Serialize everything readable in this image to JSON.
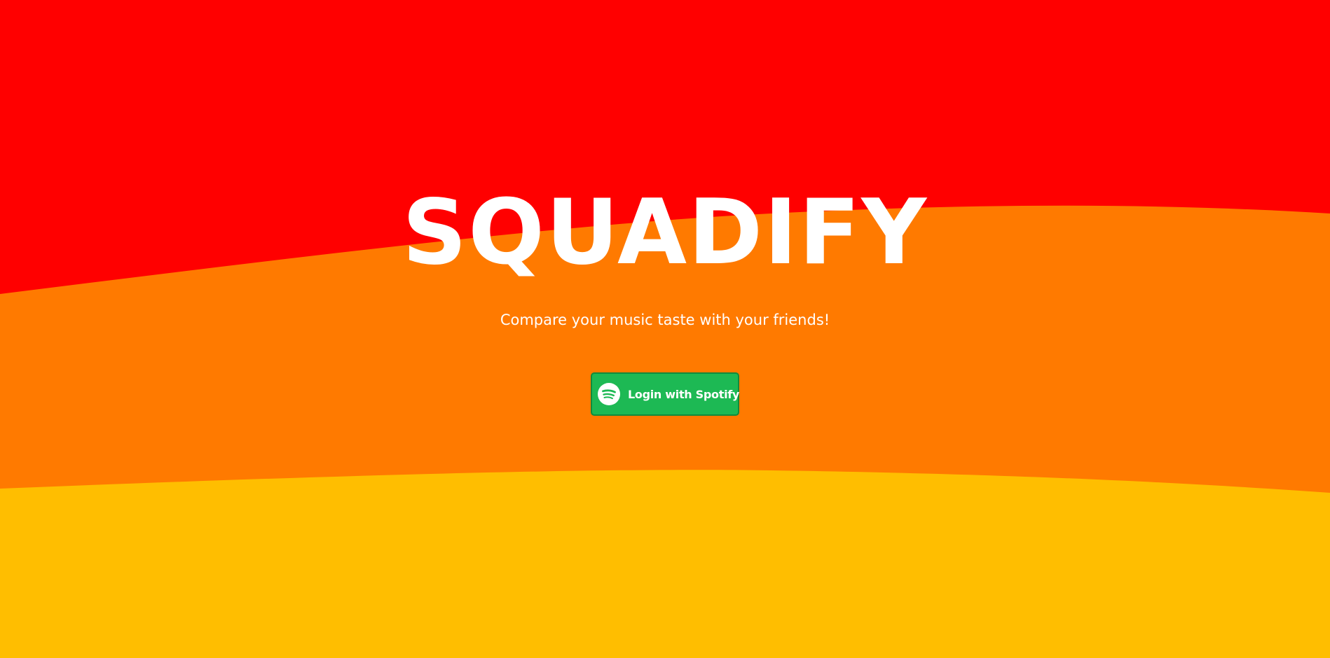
{
  "colors": {
    "top_band": "#ff0000",
    "middle_band": "#ff7a00",
    "bottom_band": "#ffbe00",
    "text": "#ffffff",
    "spotify_green": "#1db954"
  },
  "hero": {
    "title": "SQUADIFY",
    "subtitle": "Compare your music taste with your friends!"
  },
  "login_button": {
    "icon": "spotify-icon",
    "label": "Login with Spotify"
  }
}
